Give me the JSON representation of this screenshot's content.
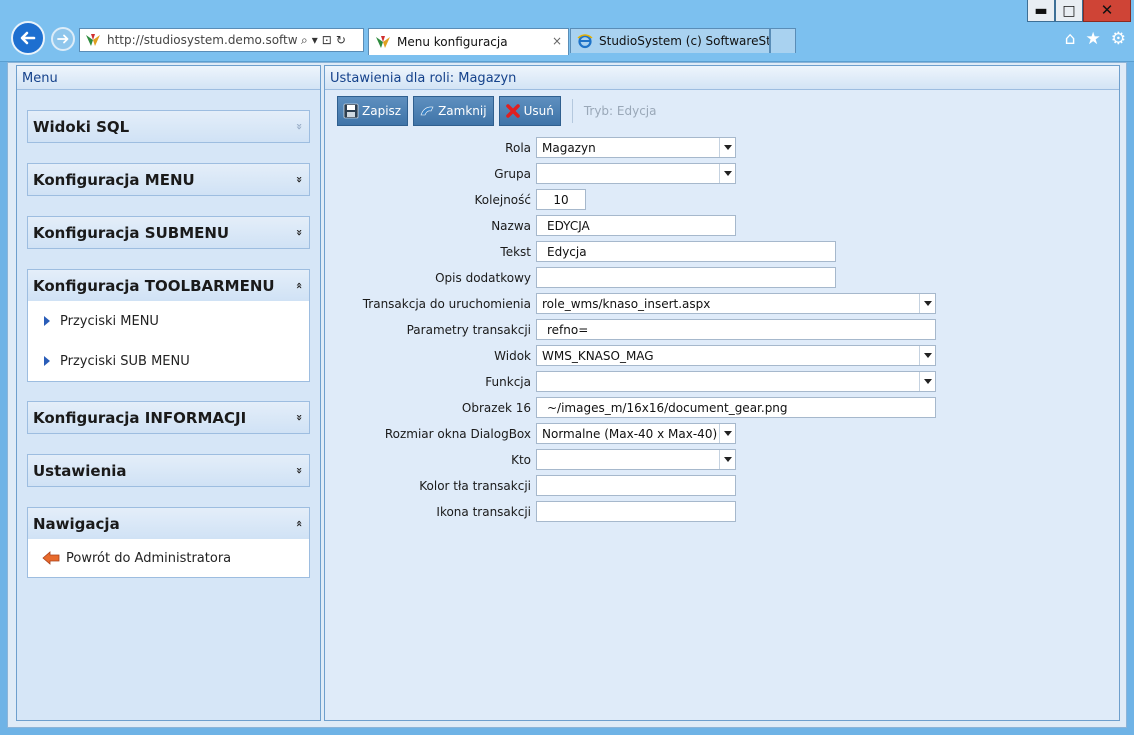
{
  "window": {
    "minimize_glyph": "▬",
    "maximize_glyph": "□",
    "close_glyph": "✕"
  },
  "browser": {
    "address": "http://studiosystem.demo.softwar...",
    "tabs": [
      {
        "label": "Menu konfiguracja",
        "active": true
      },
      {
        "label": "StudioSystem (c) SoftwareStud...",
        "active": false
      }
    ],
    "tab_close_glyph": "×",
    "addr_icons": [
      "⌕",
      "▾",
      "⊡",
      "↻"
    ],
    "tool_icons": [
      "⌂",
      "★",
      "⚙"
    ]
  },
  "left_panel": {
    "title": "Menu",
    "sections": [
      {
        "label": "Widoki SQL",
        "expanded": false,
        "chevron": "»",
        "dim": true,
        "items": []
      },
      {
        "label": "Konfiguracja MENU",
        "expanded": false,
        "chevron": "»",
        "items": []
      },
      {
        "label": "Konfiguracja SUBMENU",
        "expanded": false,
        "chevron": "»",
        "items": []
      },
      {
        "label": "Konfiguracja TOOLBARMENU",
        "expanded": true,
        "chevron": "«",
        "items": [
          "Przyciski MENU",
          "Przyciski SUB MENU"
        ]
      },
      {
        "label": "Konfiguracja INFORMACJI",
        "expanded": false,
        "chevron": "»",
        "items": []
      },
      {
        "label": "Ustawienia",
        "expanded": false,
        "chevron": "»",
        "items": []
      },
      {
        "label": "Nawigacja",
        "expanded": true,
        "chevron": "«",
        "items": [
          "Powrót do Administratora"
        ]
      }
    ]
  },
  "right_panel": {
    "title": "Ustawienia dla roli: Magazyn",
    "toolbar": {
      "save": "Zapisz",
      "close": "Zamknij",
      "delete": "Usuń",
      "mode": "Tryb: Edycja"
    },
    "form": {
      "rola": {
        "label": "Rola",
        "value": "Magazyn"
      },
      "grupa": {
        "label": "Grupa",
        "value": ""
      },
      "kolejnosc": {
        "label": "Kolejność",
        "value": "10"
      },
      "nazwa": {
        "label": "Nazwa",
        "value": "EDYCJA"
      },
      "tekst": {
        "label": "Tekst",
        "value": "Edycja"
      },
      "opis": {
        "label": "Opis dodatkowy",
        "value": ""
      },
      "transakcja": {
        "label": "Transakcja do uruchomienia",
        "value": "role_wms/knaso_insert.aspx"
      },
      "parametry": {
        "label": "Parametry transakcji",
        "value": "refno="
      },
      "widok": {
        "label": "Widok",
        "value": "WMS_KNASO_MAG"
      },
      "funkcja": {
        "label": "Funkcja",
        "value": ""
      },
      "obrazek": {
        "label": "Obrazek 16",
        "value": "~/images_m/16x16/document_gear.png"
      },
      "rozmiar": {
        "label": "Rozmiar okna DialogBox",
        "value": "Normalne (Max-40 x Max-40)"
      },
      "kto": {
        "label": "Kto",
        "value": ""
      },
      "kolor": {
        "label": "Kolor tła transakcji",
        "value": ""
      },
      "ikona": {
        "label": "Ikona transakcji",
        "value": ""
      }
    }
  },
  "colors": {
    "chrome": "#7cc0ef",
    "panel_title": "#15428b",
    "toolbar_button": "#4a7fb3",
    "back_button": "#1d6fd0",
    "close_button": "#cf4436"
  }
}
